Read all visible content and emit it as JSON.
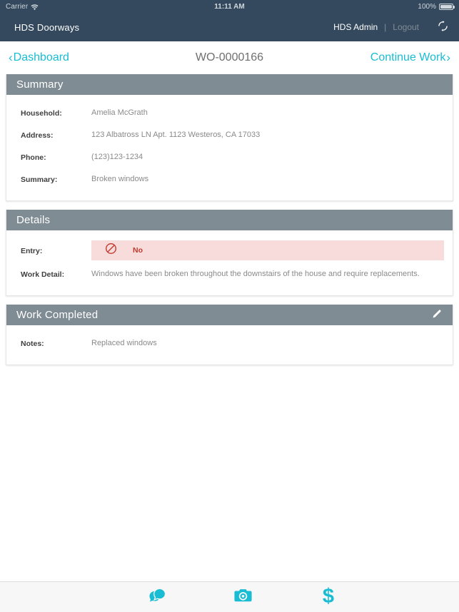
{
  "status_bar": {
    "carrier": "Carrier",
    "wifi_icon": "wifi-icon",
    "time": "11:11 AM",
    "battery_percent": "100%",
    "battery_icon": "battery-icon"
  },
  "header": {
    "brand": "HDS Doorways",
    "user": "HDS Admin",
    "separator": "|",
    "logout_label": "Logout",
    "refresh_icon": "refresh-icon"
  },
  "nav": {
    "back_chevron": "‹",
    "back_label": "Dashboard",
    "title": "WO-0000166",
    "forward_label": "Continue Work",
    "forward_chevron": "›"
  },
  "cards": [
    {
      "id": "summary",
      "title": "Summary",
      "fields": [
        {
          "label": "Household:",
          "value": "Amelia McGrath"
        },
        {
          "label": "Address:",
          "value": "123 Albatross LN Apt. 1123 Westeros, CA 17033"
        },
        {
          "label": "Phone:",
          "value": "(123)123-1234"
        },
        {
          "label": "Summary:",
          "value": "Broken windows"
        }
      ]
    },
    {
      "id": "details",
      "title": "Details",
      "entry": {
        "label": "Entry:",
        "icon": "no-entry-icon",
        "value": "No"
      },
      "fields": [
        {
          "label": "Work Detail:",
          "value": "Windows have been broken throughout the downstairs of the house and require replacements."
        }
      ]
    },
    {
      "id": "work-completed",
      "title": "Work Completed",
      "edit_icon": "pencil-icon",
      "fields": [
        {
          "label": "Notes:",
          "value": "Replaced windows"
        }
      ]
    }
  ],
  "tab_bar": {
    "items": [
      {
        "icon": "chat-icon",
        "name": "tab-messages"
      },
      {
        "icon": "camera-icon",
        "name": "tab-photos"
      },
      {
        "icon": "dollar-icon",
        "name": "tab-billing"
      }
    ]
  },
  "colors": {
    "header_bg": "#34495e",
    "card_header_bg": "#7f8c94",
    "accent": "#19bdd3",
    "danger": "#c0392b",
    "danger_bg": "#f7dcdb"
  }
}
